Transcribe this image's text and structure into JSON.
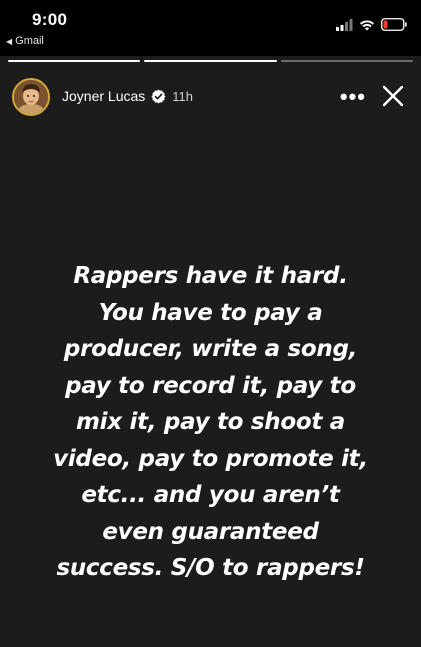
{
  "status_bar": {
    "time": "9:00",
    "back_app": "Gmail",
    "icons": [
      "signal-icon",
      "wifi-icon",
      "battery-icon"
    ]
  },
  "story": {
    "progress_segments": [
      1,
      1,
      0
    ],
    "author": {
      "name": "Joyner Lucas",
      "verified": true,
      "timestamp": "11h"
    },
    "actions": {
      "more": "•••",
      "close": "close-icon"
    },
    "text": "Rappers have it hard.\nYou have to pay a\nproducer, write a song,\npay to record it, pay to\nmix it, pay to shoot a\nvideo, pay to promote it,\netc... and you aren’t\neven guaranteed\nsuccess. S/O to rappers!"
  },
  "colors": {
    "background": "#1c1c1c",
    "status_bar": "#000000",
    "text": "#ffffff",
    "verified_badge": "#ffffff"
  }
}
